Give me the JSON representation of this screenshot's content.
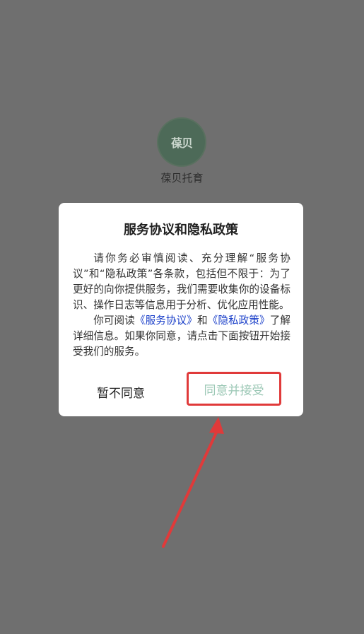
{
  "app": {
    "logo_text": "葆贝",
    "name": "葆贝托育"
  },
  "dialog": {
    "title": "服务协议和隐私政策",
    "para1": "请你务必审慎阅读、充分理解“服务协议”和“隐私政策”各条款，包括但不限于：为了更好的向你提供服务，我们需要收集你的设备标识、操作日志等信息用于分析、优化应用性能。",
    "para2_prefix": "你可阅读",
    "service_link": "《服务协议》",
    "para2_and": "和",
    "privacy_link": "《隐私政策》",
    "para2_suffix": "了解详细信息。如果你同意，请点击下面按钮开始接受我们的服务。",
    "decline_label": "暂不同意",
    "accept_label": "同意并接受"
  },
  "colors": {
    "overlay": "#6f6f6f",
    "link": "#1a3fc9",
    "accept_text": "#9cc8b6",
    "annotation_red": "#e03a3a"
  }
}
